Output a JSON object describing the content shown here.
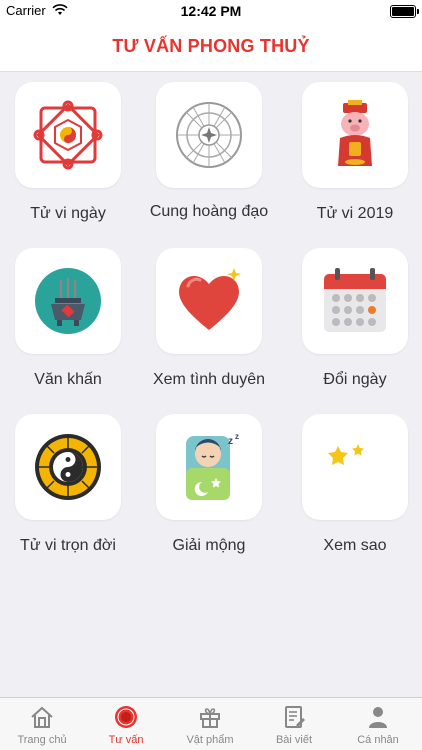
{
  "status_bar": {
    "carrier": "Carrier",
    "time": "12:42 PM"
  },
  "header": {
    "title": "TƯ VẤN PHONG THUỶ"
  },
  "grid": {
    "items": [
      {
        "label": "Tử vi ngày",
        "icon": "knot-yin-yang-icon"
      },
      {
        "label": "Cung hoàng đạo",
        "icon": "zodiac-wheel-icon"
      },
      {
        "label": "Tử vi 2019",
        "icon": "pig-god-icon"
      },
      {
        "label": "Văn khấn",
        "icon": "incense-burner-icon"
      },
      {
        "label": "Xem tình duyên",
        "icon": "heart-icon"
      },
      {
        "label": "Đổi ngày",
        "icon": "calendar-icon"
      },
      {
        "label": "Tử vi trọn đời",
        "icon": "bagua-icon"
      },
      {
        "label": "Giải mộng",
        "icon": "sleeping-child-icon"
      },
      {
        "label": "Xem sao",
        "icon": "moon-stars-icon"
      }
    ]
  },
  "tabbar": {
    "tabs": [
      {
        "label": "Trang chủ",
        "icon": "home-icon"
      },
      {
        "label": "Tư vấn",
        "icon": "compass-icon",
        "active": true
      },
      {
        "label": "Vật phẩm",
        "icon": "gift-icon"
      },
      {
        "label": "Bài viết",
        "icon": "article-icon"
      },
      {
        "label": "Cá nhân",
        "icon": "user-icon"
      }
    ]
  },
  "colors": {
    "accent": "#e8332e",
    "background": "#efeff4",
    "tab_inactive": "#888888"
  }
}
